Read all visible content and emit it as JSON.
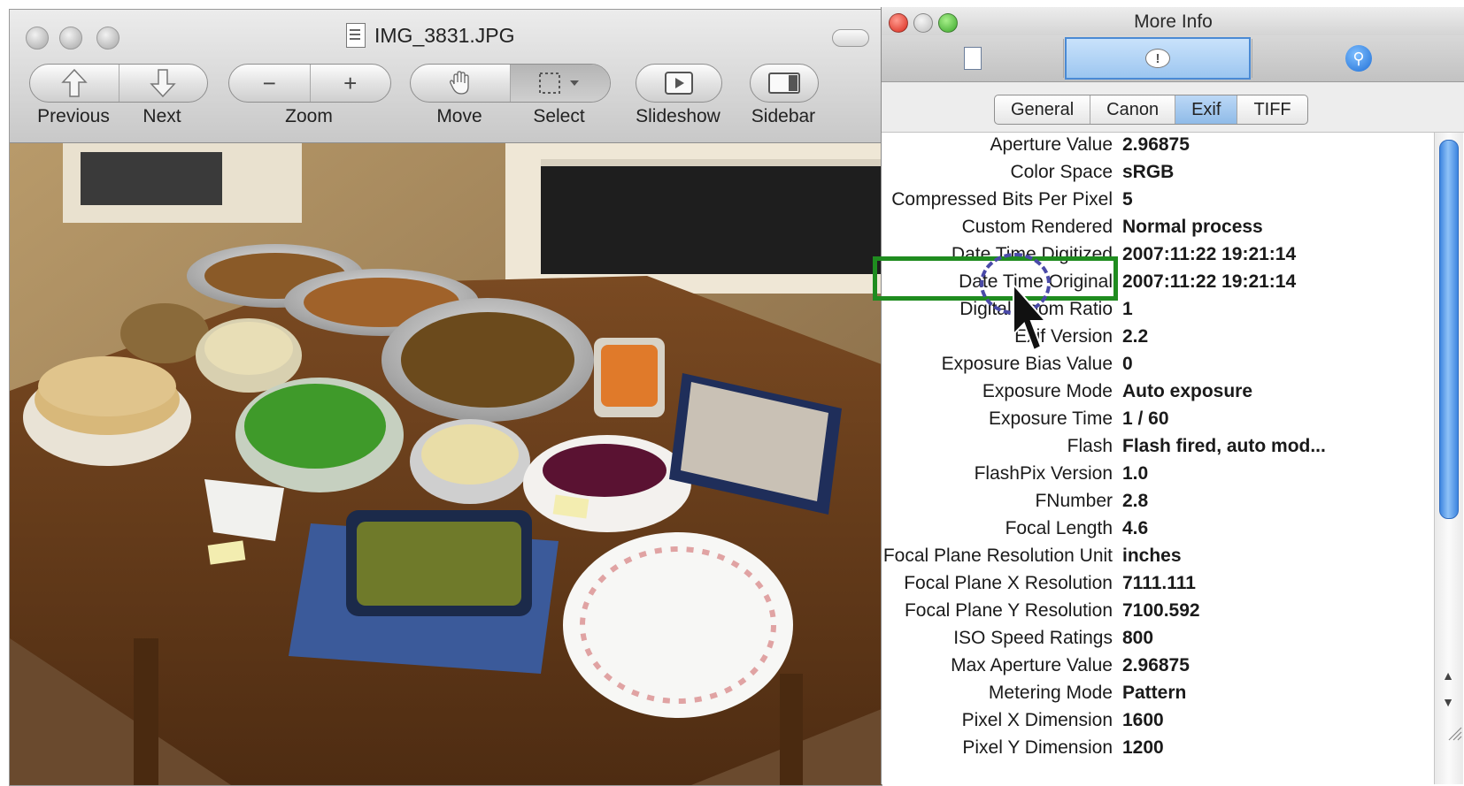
{
  "preview": {
    "title": "IMG_3831.JPG",
    "toolbar": {
      "previous": "Previous",
      "next": "Next",
      "zoom": "Zoom",
      "move": "Move",
      "select": "Select",
      "slideshow": "Slideshow",
      "sidebar": "Sidebar"
    }
  },
  "info": {
    "title": "More Info",
    "tabs": [
      "General",
      "Canon",
      "Exif",
      "TIFF"
    ],
    "active_tab": "Exif",
    "rows": [
      {
        "key": "Aperture Value",
        "value": "2.96875"
      },
      {
        "key": "Color Space",
        "value": "sRGB"
      },
      {
        "key": "Compressed Bits Per Pixel",
        "value": "5"
      },
      {
        "key": "Custom Rendered",
        "value": "Normal process"
      },
      {
        "key": "Date Time Digitized",
        "value": "2007:11:22 19:21:14"
      },
      {
        "key": "Date Time Original",
        "value": "2007:11:22 19:21:14"
      },
      {
        "key": "Digital Zoom Ratio",
        "value": "1"
      },
      {
        "key": "Exif Version",
        "value": "2.2"
      },
      {
        "key": "Exposure Bias Value",
        "value": "0"
      },
      {
        "key": "Exposure Mode",
        "value": "Auto exposure"
      },
      {
        "key": "Exposure Time",
        "value": "1 / 60"
      },
      {
        "key": "Flash",
        "value": "Flash fired, auto mod..."
      },
      {
        "key": "FlashPix Version",
        "value": "1.0"
      },
      {
        "key": "FNumber",
        "value": "2.8"
      },
      {
        "key": "Focal Length",
        "value": "4.6"
      },
      {
        "key": "Focal Plane Resolution Unit",
        "value": "inches"
      },
      {
        "key": "Focal Plane X Resolution",
        "value": "7111.111"
      },
      {
        "key": "Focal Plane Y Resolution",
        "value": "7100.592"
      },
      {
        "key": "ISO Speed Ratings",
        "value": "800"
      },
      {
        "key": "Max Aperture Value",
        "value": "2.96875"
      },
      {
        "key": "Metering Mode",
        "value": "Pattern"
      },
      {
        "key": "Pixel X Dimension",
        "value": "1600"
      },
      {
        "key": "Pixel Y Dimension",
        "value": "1200"
      }
    ]
  },
  "colors": {
    "highlight_box": "#1f8c1f",
    "cursor_circle": "#4a4aa8",
    "selected_tab": "#4a8ad4"
  }
}
